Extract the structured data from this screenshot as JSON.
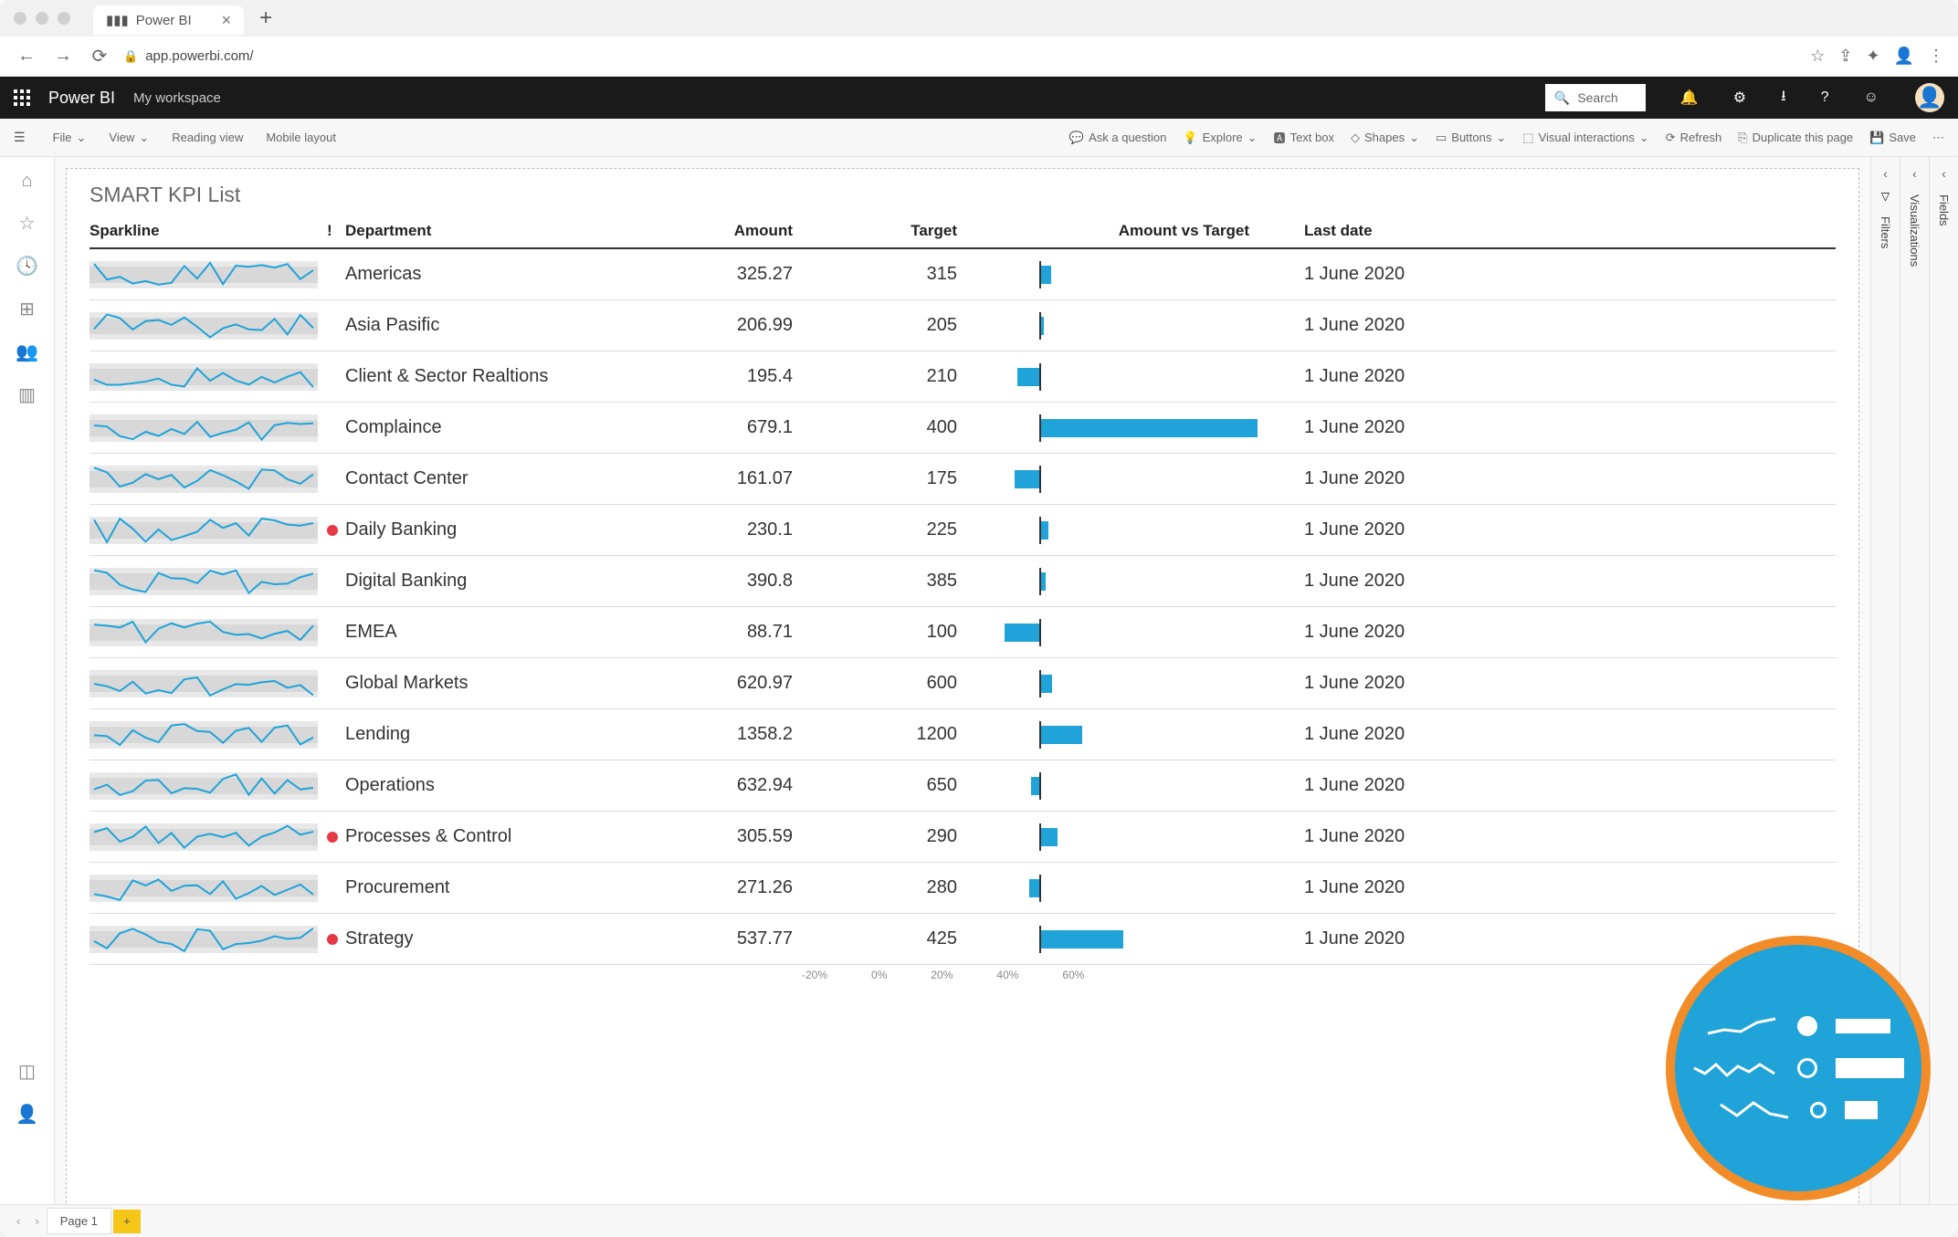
{
  "browser": {
    "tab_title": "Power BI",
    "url": "app.powerbi.com/"
  },
  "header": {
    "brand": "Power BI",
    "workspace": "My workspace",
    "search_placeholder": "Search"
  },
  "toolbar": {
    "file": "File",
    "view": "View",
    "reading_view": "Reading view",
    "mobile_layout": "Mobile layout",
    "ask": "Ask a question",
    "explore": "Explore",
    "textbox": "Text box",
    "shapes": "Shapes",
    "buttons": "Buttons",
    "visual_interactions": "Visual interactions",
    "refresh": "Refresh",
    "duplicate": "Duplicate this page",
    "save": "Save"
  },
  "panels": {
    "filters": "Filters",
    "visualizations": "Visualizations",
    "fields": "Fields"
  },
  "report": {
    "title": "SMART KPI List"
  },
  "columns": {
    "sparkline": "Sparkline",
    "bang": "!",
    "department": "Department",
    "amount": "Amount",
    "target": "Target",
    "avt": "Amount vs Target",
    "last_date": "Last date"
  },
  "rows": [
    {
      "dept": "Americas",
      "amount": "325.27",
      "target": "315",
      "date": "1 June 2020",
      "alert": false,
      "pct": 3.3
    },
    {
      "dept": "Asia Pasific",
      "amount": "206.99",
      "target": "205",
      "date": "1 June 2020",
      "alert": false,
      "pct": 1.0
    },
    {
      "dept": "Client & Sector Realtions",
      "amount": "195.4",
      "target": "210",
      "date": "1 June 2020",
      "alert": false,
      "pct": -7.0
    },
    {
      "dept": "Complaince",
      "amount": "679.1",
      "target": "400",
      "date": "1 June 2020",
      "alert": false,
      "pct": 69.8
    },
    {
      "dept": "Contact Center",
      "amount": "161.07",
      "target": "175",
      "date": "1 June 2020",
      "alert": false,
      "pct": -8.0
    },
    {
      "dept": "Daily Banking",
      "amount": "230.1",
      "target": "225",
      "date": "1 June 2020",
      "alert": true,
      "pct": 2.3
    },
    {
      "dept": "Digital Banking",
      "amount": "390.8",
      "target": "385",
      "date": "1 June 2020",
      "alert": false,
      "pct": 1.5
    },
    {
      "dept": "EMEA",
      "amount": "88.71",
      "target": "100",
      "date": "1 June 2020",
      "alert": false,
      "pct": -11.3
    },
    {
      "dept": "Global Markets",
      "amount": "620.97",
      "target": "600",
      "date": "1 June 2020",
      "alert": false,
      "pct": 3.5
    },
    {
      "dept": "Lending",
      "amount": "1358.2",
      "target": "1200",
      "date": "1 June 2020",
      "alert": false,
      "pct": 13.2
    },
    {
      "dept": "Operations",
      "amount": "632.94",
      "target": "650",
      "date": "1 June 2020",
      "alert": false,
      "pct": -2.6
    },
    {
      "dept": "Processes & Control",
      "amount": "305.59",
      "target": "290",
      "date": "1 June 2020",
      "alert": true,
      "pct": 5.4
    },
    {
      "dept": "Procurement",
      "amount": "271.26",
      "target": "280",
      "date": "1 June 2020",
      "alert": false,
      "pct": -3.1
    },
    {
      "dept": "Strategy",
      "amount": "537.77",
      "target": "425",
      "date": "1 June 2020",
      "alert": true,
      "pct": 26.5
    }
  ],
  "axis": [
    "-20%",
    "0%",
    "20%",
    "40%",
    "60%"
  ],
  "pages": {
    "page1": "Page 1"
  },
  "chart_data": {
    "type": "table",
    "title": "SMART KPI List",
    "columns": [
      "Department",
      "Amount",
      "Target",
      "Amount vs Target %",
      "Last date"
    ],
    "amount_vs_target_axis_range": [
      -20,
      70
    ],
    "data": [
      {
        "department": "Americas",
        "amount": 325.27,
        "target": 315,
        "amount_vs_target_pct": 3.3,
        "last_date": "1 June 2020"
      },
      {
        "department": "Asia Pasific",
        "amount": 206.99,
        "target": 205,
        "amount_vs_target_pct": 1.0,
        "last_date": "1 June 2020"
      },
      {
        "department": "Client & Sector Realtions",
        "amount": 195.4,
        "target": 210,
        "amount_vs_target_pct": -7.0,
        "last_date": "1 June 2020"
      },
      {
        "department": "Complaince",
        "amount": 679.1,
        "target": 400,
        "amount_vs_target_pct": 69.8,
        "last_date": "1 June 2020"
      },
      {
        "department": "Contact Center",
        "amount": 161.07,
        "target": 175,
        "amount_vs_target_pct": -8.0,
        "last_date": "1 June 2020"
      },
      {
        "department": "Daily Banking",
        "amount": 230.1,
        "target": 225,
        "amount_vs_target_pct": 2.3,
        "last_date": "1 June 2020"
      },
      {
        "department": "Digital Banking",
        "amount": 390.8,
        "target": 385,
        "amount_vs_target_pct": 1.5,
        "last_date": "1 June 2020"
      },
      {
        "department": "EMEA",
        "amount": 88.71,
        "target": 100,
        "amount_vs_target_pct": -11.3,
        "last_date": "1 June 2020"
      },
      {
        "department": "Global Markets",
        "amount": 620.97,
        "target": 600,
        "amount_vs_target_pct": 3.5,
        "last_date": "1 June 2020"
      },
      {
        "department": "Lending",
        "amount": 1358.2,
        "target": 1200,
        "amount_vs_target_pct": 13.2,
        "last_date": "1 June 2020"
      },
      {
        "department": "Operations",
        "amount": 632.94,
        "target": 650,
        "amount_vs_target_pct": -2.6,
        "last_date": "1 June 2020"
      },
      {
        "department": "Processes & Control",
        "amount": 305.59,
        "target": 290,
        "amount_vs_target_pct": 5.4,
        "last_date": "1 June 2020"
      },
      {
        "department": "Procurement",
        "amount": 271.26,
        "target": 280,
        "amount_vs_target_pct": -3.1,
        "last_date": "1 June 2020"
      },
      {
        "department": "Strategy",
        "amount": 537.77,
        "target": 425,
        "amount_vs_target_pct": 26.5,
        "last_date": "1 June 2020"
      }
    ]
  }
}
